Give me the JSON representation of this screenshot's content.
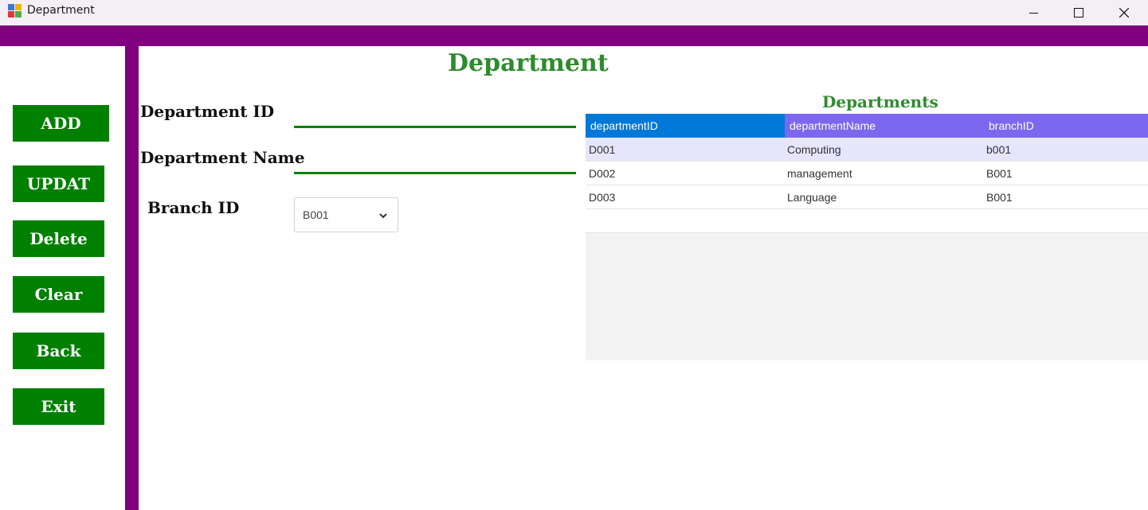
{
  "window": {
    "title": "Department",
    "controls": [
      "minimize",
      "maximize",
      "close"
    ]
  },
  "sidebar": {
    "buttons": [
      {
        "label": "ADD"
      },
      {
        "label": "UPDAT"
      },
      {
        "label": "Delete"
      },
      {
        "label": "Clear"
      },
      {
        "label": "Back"
      },
      {
        "label": "Exit"
      }
    ]
  },
  "form": {
    "title": "Department",
    "department_id_label": "Department ID",
    "department_id_value": "",
    "department_name_label": "Department Name",
    "department_name_value": "",
    "branch_id_label": "Branch ID",
    "branch_id_selected": "B001"
  },
  "grid": {
    "title": "Departments",
    "columns": [
      "departmentID",
      "departmentName",
      "branchID"
    ],
    "header_colors": [
      "#0078d7",
      "#7b68ee",
      "#7b68ee"
    ],
    "rows": [
      [
        "D001",
        "Computing",
        "b001"
      ],
      [
        "D002",
        "management",
        "B001"
      ],
      [
        "D003",
        "Language",
        "B001"
      ]
    ]
  },
  "colors": {
    "accent_purple": "#800080",
    "button_green": "#008000",
    "title_green": "#2e8b2e"
  }
}
